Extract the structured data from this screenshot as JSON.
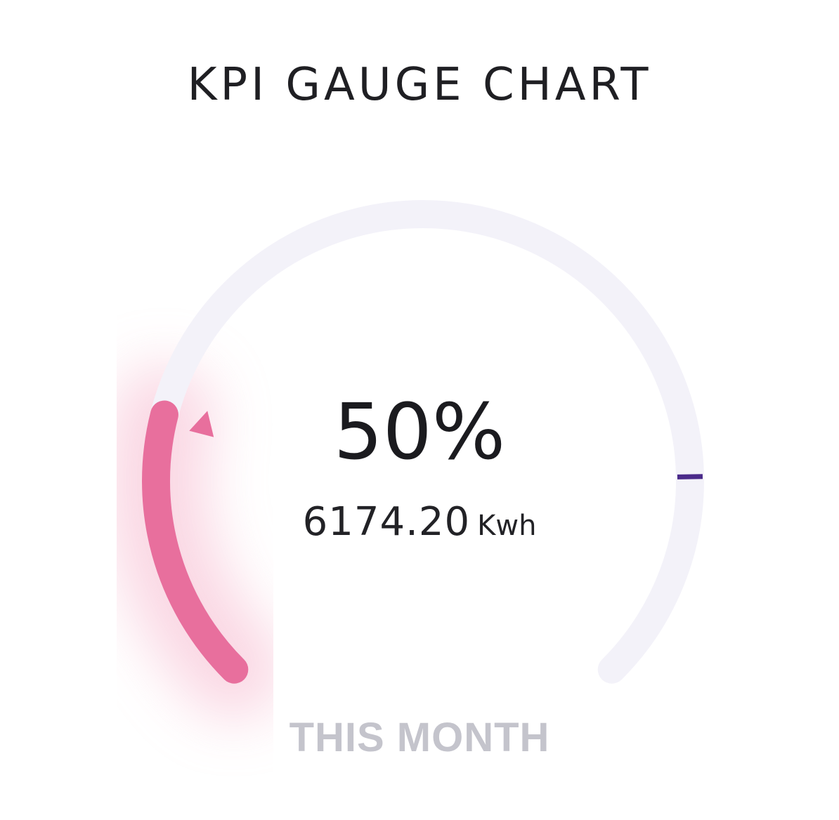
{
  "card": {
    "title": "KPI GAUGE CHART",
    "percent_label": "50%",
    "value": "6174.20",
    "unit": "Kwh",
    "period": "THIS MONTH"
  },
  "chart_data": {
    "type": "gauge",
    "title": "KPI GAUGE CHART",
    "progress": 0.22,
    "target": 0.83,
    "label_value": "50%",
    "sub_value": 6174.2,
    "unit": "Kwh",
    "period": "THIS MONTH",
    "colors": {
      "track": "#f3f2f9",
      "progress": "#e86f9d",
      "target_marker": "#4a2a8a",
      "glow": "#f6b6cc"
    }
  }
}
